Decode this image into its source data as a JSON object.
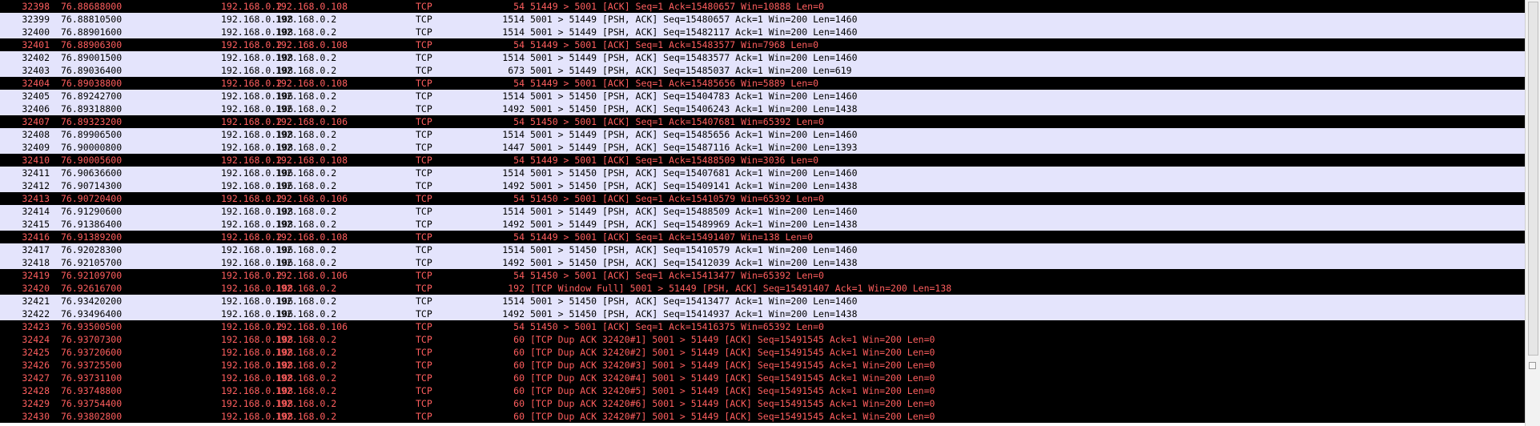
{
  "packets": [
    {
      "no": "32398",
      "time": "76.88688000",
      "src": "192.168.0.2",
      "dst": "192.168.0.108",
      "proto": "TCP",
      "len": "54",
      "info": "51449 > 5001 [ACK] Seq=1 Ack=15480657 Win=10888 Len=0",
      "style": "black"
    },
    {
      "no": "32399",
      "time": "76.88810500",
      "src": "192.168.0.108",
      "dst": "192.168.0.2",
      "proto": "TCP",
      "len": "1514",
      "info": "5001 > 51449 [PSH, ACK] Seq=15480657 Ack=1 Win=200 Len=1460",
      "style": "normal"
    },
    {
      "no": "32400",
      "time": "76.88901600",
      "src": "192.168.0.108",
      "dst": "192.168.0.2",
      "proto": "TCP",
      "len": "1514",
      "info": "5001 > 51449 [PSH, ACK] Seq=15482117 Ack=1 Win=200 Len=1460",
      "style": "normal"
    },
    {
      "no": "32401",
      "time": "76.88906300",
      "src": "192.168.0.2",
      "dst": "192.168.0.108",
      "proto": "TCP",
      "len": "54",
      "info": "51449 > 5001 [ACK] Seq=1 Ack=15483577 Win=7968 Len=0",
      "style": "black"
    },
    {
      "no": "32402",
      "time": "76.89001500",
      "src": "192.168.0.108",
      "dst": "192.168.0.2",
      "proto": "TCP",
      "len": "1514",
      "info": "5001 > 51449 [PSH, ACK] Seq=15483577 Ack=1 Win=200 Len=1460",
      "style": "normal"
    },
    {
      "no": "32403",
      "time": "76.89036400",
      "src": "192.168.0.108",
      "dst": "192.168.0.2",
      "proto": "TCP",
      "len": "673",
      "info": "5001 > 51449 [PSH, ACK] Seq=15485037 Ack=1 Win=200 Len=619",
      "style": "normal"
    },
    {
      "no": "32404",
      "time": "76.89038800",
      "src": "192.168.0.2",
      "dst": "192.168.0.108",
      "proto": "TCP",
      "len": "54",
      "info": "51449 > 5001 [ACK] Seq=1 Ack=15485656 Win=5889 Len=0",
      "style": "black"
    },
    {
      "no": "32405",
      "time": "76.89242700",
      "src": "192.168.0.106",
      "dst": "192.168.0.2",
      "proto": "TCP",
      "len": "1514",
      "info": "5001 > 51450 [PSH, ACK] Seq=15404783 Ack=1 Win=200 Len=1460",
      "style": "normal"
    },
    {
      "no": "32406",
      "time": "76.89318800",
      "src": "192.168.0.106",
      "dst": "192.168.0.2",
      "proto": "TCP",
      "len": "1492",
      "info": "5001 > 51450 [PSH, ACK] Seq=15406243 Ack=1 Win=200 Len=1438",
      "style": "normal"
    },
    {
      "no": "32407",
      "time": "76.89323200",
      "src": "192.168.0.2",
      "dst": "192.168.0.106",
      "proto": "TCP",
      "len": "54",
      "info": "51450 > 5001 [ACK] Seq=1 Ack=15407681 Win=65392 Len=0",
      "style": "black"
    },
    {
      "no": "32408",
      "time": "76.89906500",
      "src": "192.168.0.108",
      "dst": "192.168.0.2",
      "proto": "TCP",
      "len": "1514",
      "info": "5001 > 51449 [PSH, ACK] Seq=15485656 Ack=1 Win=200 Len=1460",
      "style": "normal"
    },
    {
      "no": "32409",
      "time": "76.90000800",
      "src": "192.168.0.108",
      "dst": "192.168.0.2",
      "proto": "TCP",
      "len": "1447",
      "info": "5001 > 51449 [PSH, ACK] Seq=15487116 Ack=1 Win=200 Len=1393",
      "style": "normal"
    },
    {
      "no": "32410",
      "time": "76.90005600",
      "src": "192.168.0.2",
      "dst": "192.168.0.108",
      "proto": "TCP",
      "len": "54",
      "info": "51449 > 5001 [ACK] Seq=1 Ack=15488509 Win=3036 Len=0",
      "style": "black"
    },
    {
      "no": "32411",
      "time": "76.90636600",
      "src": "192.168.0.106",
      "dst": "192.168.0.2",
      "proto": "TCP",
      "len": "1514",
      "info": "5001 > 51450 [PSH, ACK] Seq=15407681 Ack=1 Win=200 Len=1460",
      "style": "normal"
    },
    {
      "no": "32412",
      "time": "76.90714300",
      "src": "192.168.0.106",
      "dst": "192.168.0.2",
      "proto": "TCP",
      "len": "1492",
      "info": "5001 > 51450 [PSH, ACK] Seq=15409141 Ack=1 Win=200 Len=1438",
      "style": "normal"
    },
    {
      "no": "32413",
      "time": "76.90720400",
      "src": "192.168.0.2",
      "dst": "192.168.0.106",
      "proto": "TCP",
      "len": "54",
      "info": "51450 > 5001 [ACK] Seq=1 Ack=15410579 Win=65392 Len=0",
      "style": "black"
    },
    {
      "no": "32414",
      "time": "76.91290600",
      "src": "192.168.0.108",
      "dst": "192.168.0.2",
      "proto": "TCP",
      "len": "1514",
      "info": "5001 > 51449 [PSH, ACK] Seq=15488509 Ack=1 Win=200 Len=1460",
      "style": "normal"
    },
    {
      "no": "32415",
      "time": "76.91386400",
      "src": "192.168.0.108",
      "dst": "192.168.0.2",
      "proto": "TCP",
      "len": "1492",
      "info": "5001 > 51449 [PSH, ACK] Seq=15489969 Ack=1 Win=200 Len=1438",
      "style": "normal"
    },
    {
      "no": "32416",
      "time": "76.91389200",
      "src": "192.168.0.2",
      "dst": "192.168.0.108",
      "proto": "TCP",
      "len": "54",
      "info": "51449 > 5001 [ACK] Seq=1 Ack=15491407 Win=138 Len=0",
      "style": "black"
    },
    {
      "no": "32417",
      "time": "76.92028300",
      "src": "192.168.0.106",
      "dst": "192.168.0.2",
      "proto": "TCP",
      "len": "1514",
      "info": "5001 > 51450 [PSH, ACK] Seq=15410579 Ack=1 Win=200 Len=1460",
      "style": "normal"
    },
    {
      "no": "32418",
      "time": "76.92105700",
      "src": "192.168.0.106",
      "dst": "192.168.0.2",
      "proto": "TCP",
      "len": "1492",
      "info": "5001 > 51450 [PSH, ACK] Seq=15412039 Ack=1 Win=200 Len=1438",
      "style": "normal"
    },
    {
      "no": "32419",
      "time": "76.92109700",
      "src": "192.168.0.2",
      "dst": "192.168.0.106",
      "proto": "TCP",
      "len": "54",
      "info": "51450 > 5001 [ACK] Seq=1 Ack=15413477 Win=65392 Len=0",
      "style": "black"
    },
    {
      "no": "32420",
      "time": "76.92616700",
      "src": "192.168.0.108",
      "dst": "192.168.0.2",
      "proto": "TCP",
      "len": "192",
      "info": "[TCP Window Full] 5001 > 51449 [PSH, ACK] Seq=15491407 Ack=1 Win=200 Len=138",
      "style": "black"
    },
    {
      "no": "32421",
      "time": "76.93420200",
      "src": "192.168.0.106",
      "dst": "192.168.0.2",
      "proto": "TCP",
      "len": "1514",
      "info": "5001 > 51450 [PSH, ACK] Seq=15413477 Ack=1 Win=200 Len=1460",
      "style": "normal"
    },
    {
      "no": "32422",
      "time": "76.93496400",
      "src": "192.168.0.106",
      "dst": "192.168.0.2",
      "proto": "TCP",
      "len": "1492",
      "info": "5001 > 51450 [PSH, ACK] Seq=15414937 Ack=1 Win=200 Len=1438",
      "style": "normal"
    },
    {
      "no": "32423",
      "time": "76.93500500",
      "src": "192.168.0.2",
      "dst": "192.168.0.106",
      "proto": "TCP",
      "len": "54",
      "info": "51450 > 5001 [ACK] Seq=1 Ack=15416375 Win=65392 Len=0",
      "style": "black"
    },
    {
      "no": "32424",
      "time": "76.93707300",
      "src": "192.168.0.108",
      "dst": "192.168.0.2",
      "proto": "TCP",
      "len": "60",
      "info": "[TCP Dup ACK 32420#1] 5001 > 51449 [ACK] Seq=15491545 Ack=1 Win=200 Len=0",
      "style": "black"
    },
    {
      "no": "32425",
      "time": "76.93720600",
      "src": "192.168.0.108",
      "dst": "192.168.0.2",
      "proto": "TCP",
      "len": "60",
      "info": "[TCP Dup ACK 32420#2] 5001 > 51449 [ACK] Seq=15491545 Ack=1 Win=200 Len=0",
      "style": "black"
    },
    {
      "no": "32426",
      "time": "76.93725500",
      "src": "192.168.0.108",
      "dst": "192.168.0.2",
      "proto": "TCP",
      "len": "60",
      "info": "[TCP Dup ACK 32420#3] 5001 > 51449 [ACK] Seq=15491545 Ack=1 Win=200 Len=0",
      "style": "black"
    },
    {
      "no": "32427",
      "time": "76.93731100",
      "src": "192.168.0.108",
      "dst": "192.168.0.2",
      "proto": "TCP",
      "len": "60",
      "info": "[TCP Dup ACK 32420#4] 5001 > 51449 [ACK] Seq=15491545 Ack=1 Win=200 Len=0",
      "style": "black"
    },
    {
      "no": "32428",
      "time": "76.93748800",
      "src": "192.168.0.108",
      "dst": "192.168.0.2",
      "proto": "TCP",
      "len": "60",
      "info": "[TCP Dup ACK 32420#5] 5001 > 51449 [ACK] Seq=15491545 Ack=1 Win=200 Len=0",
      "style": "black"
    },
    {
      "no": "32429",
      "time": "76.93754400",
      "src": "192.168.0.108",
      "dst": "192.168.0.2",
      "proto": "TCP",
      "len": "60",
      "info": "[TCP Dup ACK 32420#6] 5001 > 51449 [ACK] Seq=15491545 Ack=1 Win=200 Len=0",
      "style": "black"
    },
    {
      "no": "32430",
      "time": "76.93802800",
      "src": "192.168.0.108",
      "dst": "192.168.0.2",
      "proto": "TCP",
      "len": "60",
      "info": "[TCP Dup ACK 32420#7] 5001 > 51449 [ACK] Seq=15491545 Ack=1 Win=200 Len=0",
      "style": "black"
    }
  ],
  "colors": {
    "normal_bg": "#e4e4fc",
    "alert_bg": "#000000",
    "alert_fg": "#ff5e5e"
  }
}
